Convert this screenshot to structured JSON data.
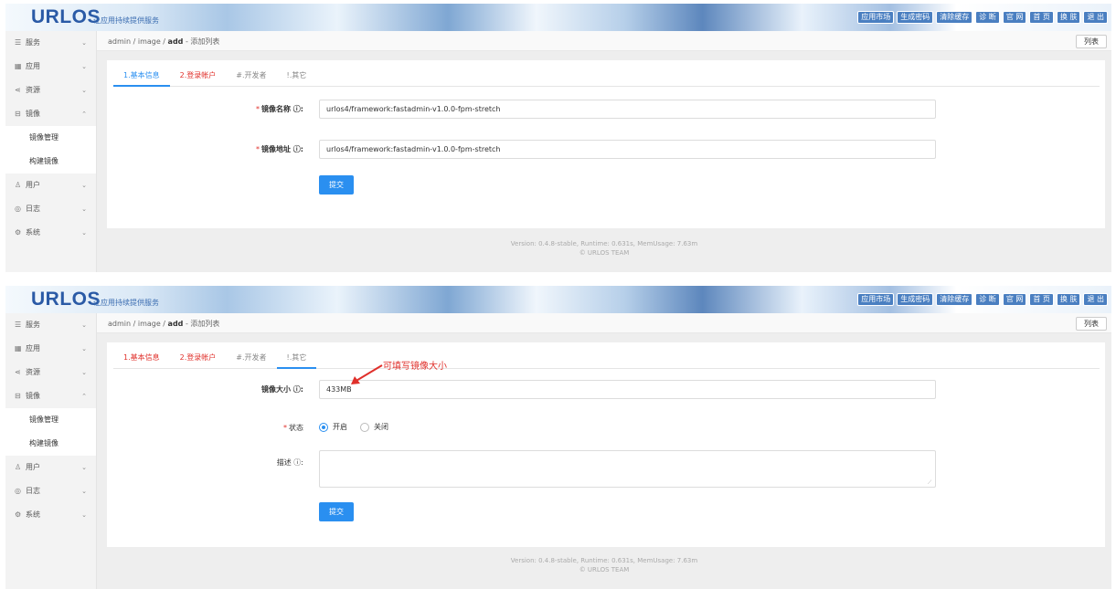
{
  "header": {
    "logo": "URLOS",
    "slogan": "让应用持续提供服务",
    "nav": [
      "应用市场",
      "生成密码",
      "清除缓存",
      "诊 断",
      "官 网",
      "首 页",
      "换 肤",
      "退 出"
    ]
  },
  "sidebar": {
    "items": [
      {
        "label": "服务",
        "arrow": "⌄"
      },
      {
        "label": "应用",
        "arrow": "⌄"
      },
      {
        "label": "资源",
        "arrow": "⌄"
      },
      {
        "label": "镜像",
        "arrow": "⌃"
      }
    ],
    "sub_items": [
      "镜像管理",
      "构建镜像"
    ],
    "items_after": [
      {
        "label": "用户",
        "arrow": "⌄"
      },
      {
        "label": "日志",
        "arrow": "⌄"
      },
      {
        "label": "系统",
        "arrow": "⌄"
      }
    ]
  },
  "breadcrumb": {
    "prefix": "admin / image / ",
    "bold": "add",
    "suffix": " - 添加列表"
  },
  "list_button": "列表",
  "tabs": [
    "1.基本信息",
    "2.登录帐户",
    "#.开发者",
    "!.其它"
  ],
  "panel1": {
    "fields": [
      {
        "label": "镜像名称 ⓘ:",
        "value": "urlos4/framework:fastadmin-v1.0.0-fpm-stretch"
      },
      {
        "label": "镜像地址 ⓘ:",
        "value": "urlos4/framework:fastadmin-v1.0.0-fpm-stretch"
      }
    ],
    "submit": "提交"
  },
  "panel2": {
    "size_label": "镜像大小 ⓘ:",
    "size_value": "433MB",
    "status_label": "状态",
    "status_on": "开启",
    "status_off": "关闭",
    "desc_label": "描述 ⓘ:",
    "desc_value": "",
    "submit": "提交",
    "annotation": "可填写镜像大小"
  },
  "footer": {
    "line1": "Version: 0.4.8-stable,   Runtime: 0.631s,   MemUsage: 7.63m",
    "line2": "© URLOS TEAM"
  },
  "colors": {
    "accent": "#2a8ff0",
    "required": "#e0302b",
    "nav_button": "#4a7fc1"
  },
  "icons": {
    "sidebar": [
      "server-icon",
      "apps-icon",
      "share-icon",
      "disk-icon",
      "user-icon",
      "eye-icon",
      "settings-icon"
    ]
  }
}
